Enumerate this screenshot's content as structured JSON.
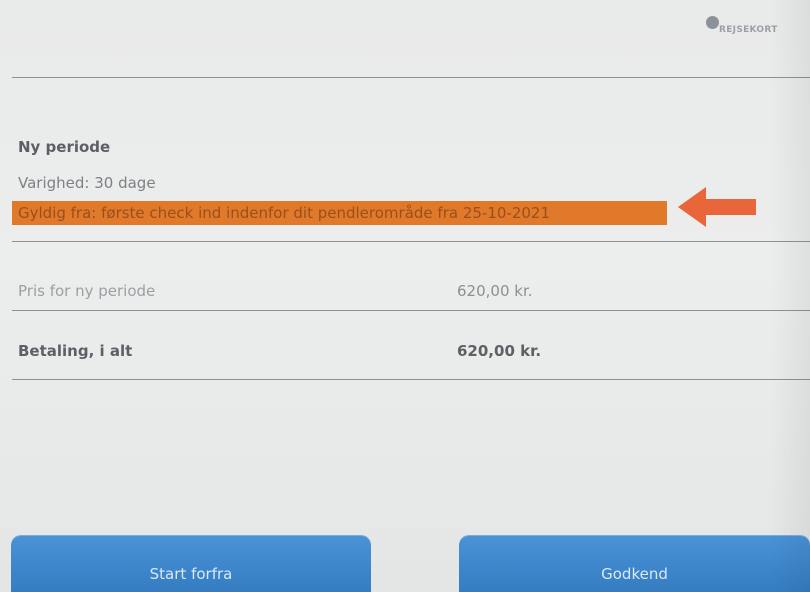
{
  "header": {
    "logo_text": "REJSEKORT",
    "logo_icon": "rejsekort-logo-icon"
  },
  "period": {
    "title": "Ny periode",
    "duration": "Varighed: 30 dage",
    "valid_from": "Gyldig fra: første check ind indenfor dit pendlerområde fra 25-10-2021",
    "highlight_color": "#e0792a",
    "arrow_icon": "arrow-left-icon",
    "arrow_color": "#e8663a"
  },
  "price": {
    "label": "Pris for ny periode",
    "value": "620,00 kr."
  },
  "total": {
    "label": "Betaling, i alt",
    "value": "620,00 kr."
  },
  "buttons": {
    "restart_label": "Start forfra",
    "approve_label": "Godkend",
    "color": "#3b84c9"
  }
}
